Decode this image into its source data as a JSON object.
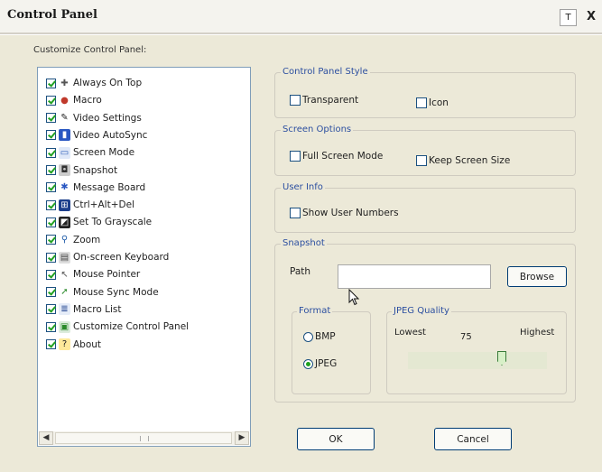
{
  "window": {
    "title": "Control Panel",
    "help_label": "T",
    "close_label": "X"
  },
  "customize": {
    "label": "Customize Control Panel:",
    "items": [
      {
        "label": "Always On Top",
        "icon": "pin-icon"
      },
      {
        "label": "Macro",
        "icon": "macro-icon"
      },
      {
        "label": "Video Settings",
        "icon": "video-settings-icon"
      },
      {
        "label": "Video AutoSync",
        "icon": "video-autosync-icon"
      },
      {
        "label": "Screen Mode",
        "icon": "screen-mode-icon"
      },
      {
        "label": "Snapshot",
        "icon": "camera-icon"
      },
      {
        "label": "Message Board",
        "icon": "message-board-icon"
      },
      {
        "label": "Ctrl+Alt+Del",
        "icon": "ctrl-alt-del-icon"
      },
      {
        "label": "Set To Grayscale",
        "icon": "grayscale-icon"
      },
      {
        "label": "Zoom",
        "icon": "zoom-icon"
      },
      {
        "label": "On-screen Keyboard",
        "icon": "keyboard-icon"
      },
      {
        "label": "Mouse Pointer",
        "icon": "mouse-pointer-icon"
      },
      {
        "label": "Mouse Sync Mode",
        "icon": "mouse-sync-icon"
      },
      {
        "label": "Macro List",
        "icon": "macro-list-icon"
      },
      {
        "label": "Customize Control Panel",
        "icon": "customize-icon"
      },
      {
        "label": "About",
        "icon": "about-icon"
      }
    ]
  },
  "style": {
    "title": "Control Panel Style",
    "transparent": "Transparent",
    "icon": "Icon"
  },
  "screen": {
    "title": "Screen Options",
    "full_screen": "Full Screen Mode",
    "keep_size": "Keep Screen Size"
  },
  "user": {
    "title": "User Info",
    "show_numbers": "Show User Numbers"
  },
  "snapshot": {
    "title": "Snapshot",
    "path_label": "Path",
    "path_value": "",
    "browse": "Browse",
    "format_title": "Format",
    "formats": [
      "BMP",
      "JPEG"
    ],
    "selected_format": "JPEG",
    "quality_title": "JPEG Quality",
    "lowest": "Lowest",
    "highest": "Highest",
    "quality": "75"
  },
  "buttons": {
    "ok": "OK",
    "cancel": "Cancel"
  },
  "colors": {
    "group_title": "#2c4fa0",
    "check_green": "#21a121",
    "border_blue": "#1c5180"
  }
}
